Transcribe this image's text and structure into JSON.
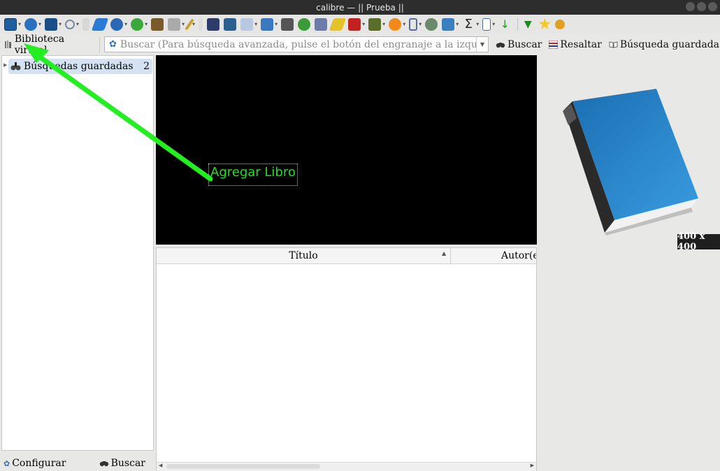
{
  "window": {
    "title": "calibre — || Prueba ||"
  },
  "toolbar": {
    "groups": [
      {
        "icon": "add-book-icon",
        "dropdown": true
      },
      {
        "icon": "edit-metadata-icon",
        "dropdown": true
      },
      {
        "icon": "convert-books-icon",
        "dropdown": true
      },
      {
        "icon": "search-icon",
        "dropdown": true
      },
      {
        "icon": "select-icon",
        "dropdown": false
      },
      {
        "icon": "highlight-pen-icon",
        "dropdown": false
      },
      {
        "icon": "get-books-globe-icon",
        "dropdown": true
      },
      {
        "icon": "recycle-icon",
        "dropdown": true
      },
      {
        "icon": "library-icon",
        "dropdown": false
      },
      {
        "icon": "device-icon",
        "dropdown": true
      },
      {
        "icon": "pencil-icon",
        "dropdown": true
      },
      {
        "icon": "save-icon",
        "dropdown": false
      },
      {
        "icon": "news-icon",
        "dropdown": false
      },
      {
        "icon": "view-icon",
        "dropdown": false
      },
      {
        "icon": "zoom-page-icon",
        "dropdown": true
      },
      {
        "icon": "book-details-icon",
        "dropdown": true
      },
      {
        "icon": "catalog-icon",
        "dropdown": false
      },
      {
        "icon": "check-library-icon",
        "dropdown": false
      },
      {
        "icon": "stack-books-icon",
        "dropdown": false
      },
      {
        "icon": "marker-icon",
        "dropdown": false
      },
      {
        "icon": "red-book-icon",
        "dropdown": true
      },
      {
        "icon": "download-book-icon",
        "dropdown": true
      },
      {
        "icon": "orange-disk-icon",
        "dropdown": true
      },
      {
        "icon": "brackets-icon",
        "dropdown": true
      },
      {
        "icon": "polish-icon",
        "dropdown": false
      },
      {
        "icon": "tweak-icon",
        "dropdown": true
      },
      {
        "icon": "sigma-icon",
        "dropdown": true
      },
      {
        "icon": "column-icon",
        "dropdown": true
      },
      {
        "icon": "sort-az-icon",
        "dropdown": false
      },
      {
        "icon": "green-down-arrow-icon",
        "dropdown": false
      },
      {
        "icon": "star-icon",
        "dropdown": false
      },
      {
        "icon": "find-key-icon",
        "dropdown": false
      }
    ]
  },
  "searchbar": {
    "virtual_library": "Biblioteca virtual",
    "placeholder": "Buscar (Para búsqueda avanzada, pulse el botón del engranaje a la izquierda)",
    "search_button": "Buscar",
    "highlight_button": "Resaltar",
    "saved_search_button": "Búsqueda guardada"
  },
  "tag_browser": {
    "items": [
      {
        "label": "Búsquedas guardadas",
        "count": "2"
      }
    ],
    "configure": "Configurar",
    "find": "Buscar"
  },
  "annotation": {
    "label": "Agregar Libro",
    "color": "#22dd22"
  },
  "book_list": {
    "columns": [
      "Título",
      "Autor(es"
    ]
  },
  "cover_panel": {
    "dimensions": "400 x 400",
    "book_color": "#2f86c8"
  }
}
